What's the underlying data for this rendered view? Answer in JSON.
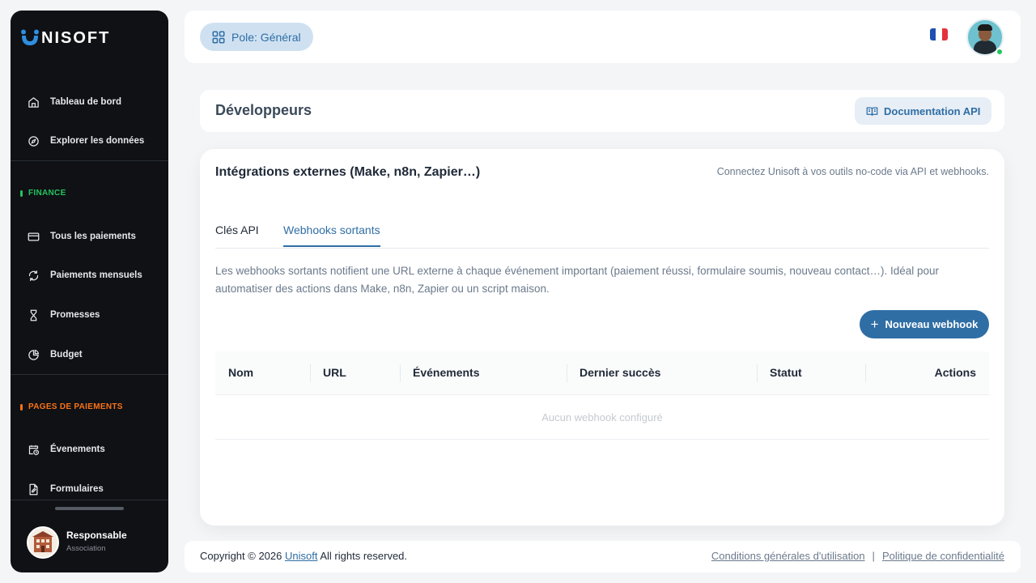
{
  "app": {
    "logo_text": "NISOFT"
  },
  "sidebar": {
    "top_items": [
      {
        "label": "Tableau de bord",
        "icon": "home-icon"
      },
      {
        "label": "Explorer les données",
        "icon": "compass-icon"
      }
    ],
    "sections": [
      {
        "label": "FINANCE",
        "color": "#22c55e",
        "items": [
          {
            "label": "Tous les paiements",
            "icon": "credit-card-icon"
          },
          {
            "label": "Paiements mensuels",
            "icon": "refresh-icon"
          },
          {
            "label": "Promesses",
            "icon": "hourglass-icon"
          },
          {
            "label": "Budget",
            "icon": "pie-chart-icon"
          }
        ]
      },
      {
        "label": "PAGES DE PAIEMENTS",
        "color": "#f97316",
        "items": [
          {
            "label": "Évenements",
            "icon": "calendar-clock-icon"
          },
          {
            "label": "Formulaires",
            "icon": "file-edit-icon"
          }
        ]
      }
    ],
    "user": {
      "name": "Responsable",
      "role": "Association"
    }
  },
  "topbar": {
    "pole_label": "Pole: Général",
    "flag_colors": [
      "#1e4fb3",
      "#ffffff",
      "#e4323c"
    ]
  },
  "header": {
    "title": "Développeurs",
    "doc_button": "Documentation API"
  },
  "integrations": {
    "title": "Intégrations externes (Make, n8n, Zapier…)",
    "subtitle": "Connectez Unisoft à vos outils no-code via API et webhooks.",
    "tabs": [
      {
        "label": "Clés API",
        "active": false
      },
      {
        "label": "Webhooks sortants",
        "active": true
      }
    ],
    "description": "Les webhooks sortants notifient une URL externe à chaque événement important (paiement réussi, formulaire soumis, nouveau contact…). Idéal pour automatiser des actions dans Make, n8n, Zapier ou un script maison.",
    "new_button": "Nouveau webhook",
    "table": {
      "columns": [
        "Nom",
        "URL",
        "Événements",
        "Dernier succès",
        "Statut",
        "Actions"
      ],
      "empty_text": "Aucun webhook configuré"
    }
  },
  "footer": {
    "copyright_prefix": "Copyright © 2026",
    "brand_link": "Unisoft",
    "rights": "All rights reserved.",
    "terms_link": "Conditions générales d'utilisation",
    "separator": "|",
    "privacy_link": "Politique de confidentialité"
  },
  "colors": {
    "accent": "#2f6ea5",
    "sidebar_bg": "#0f1115",
    "online": "#22c55e"
  }
}
